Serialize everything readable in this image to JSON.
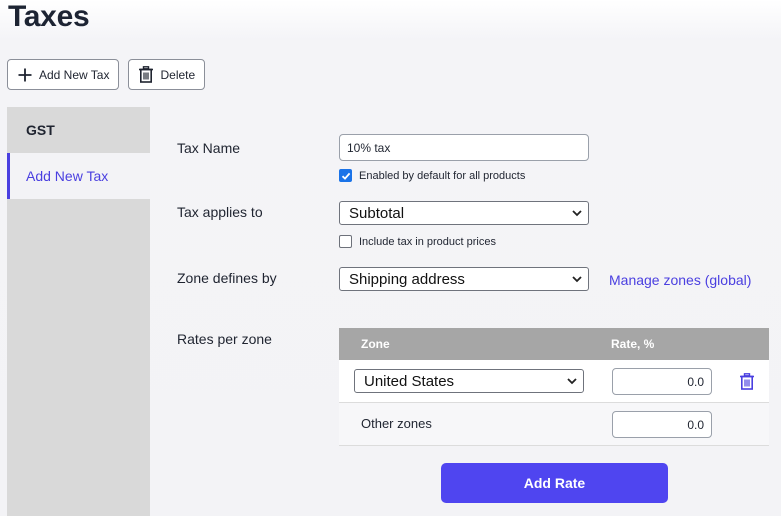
{
  "page": {
    "title": "Taxes"
  },
  "toolbar": {
    "add_label": "Add New Tax",
    "delete_label": "Delete"
  },
  "sidebar": {
    "items": [
      {
        "label": "GST"
      },
      {
        "label": "Add New Tax"
      }
    ]
  },
  "form": {
    "tax_name": {
      "label": "Tax Name",
      "value": "10% tax"
    },
    "enabled_default": {
      "label": "Enabled by default for all products",
      "checked": true
    },
    "applies_to": {
      "label": "Tax applies to",
      "value": "Subtotal"
    },
    "include_tax": {
      "label": "Include tax in product prices",
      "checked": false
    },
    "zone_defines": {
      "label": "Zone defines by",
      "value": "Shipping address"
    },
    "manage_zones_link": "Manage zones (global)",
    "rates_label": "Rates per zone"
  },
  "rates_table": {
    "headers": {
      "zone": "Zone",
      "rate": "Rate, %"
    },
    "rows": [
      {
        "zone": "United States",
        "rate": "0.0"
      },
      {
        "zone": "Other zones",
        "rate": "0.0"
      }
    ],
    "add_button": "Add Rate"
  },
  "colors": {
    "accent": "#4f45f0",
    "link": "#4a3fe0",
    "sidebar": "#d9d9d9",
    "table_header": "#a6a6a6"
  }
}
